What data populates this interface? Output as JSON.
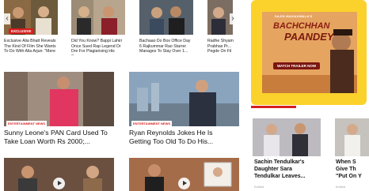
{
  "carousel": {
    "prev_icon": "chevron-left-icon",
    "next_icon": "chevron-right-icon",
    "badge": "EXCLUSIVE",
    "items": [
      {
        "caption": "Exclusive Alia Bhatt Reveals The Kind Of Film She Wants To Do With Alia Arjun: \"Mere"
      },
      {
        "caption": "Did You Know? Bappi Lahiri Once Sued Rap Legend Dr Dre For Plagiarising His So..."
      },
      {
        "caption": "Bachaao Do Box Office Day 6 Rajkummar Rao Starrer Manages To Stay Over 1..."
      },
      {
        "caption": "Radhe Shyam Prabhas Pr... Pegde On Fil"
      }
    ]
  },
  "ad": {
    "small_text": "SAJID NADIADWALA'S",
    "title_line1": "BACHCHHAN",
    "title_line2": "PAANDEY",
    "cta": "WATCH TRAILER NOW"
  },
  "stories": [
    {
      "badge": "ENTERTAINMENT NEWS",
      "headline_line1": "Sunny Leone's PAN Card Used To",
      "headline_line2": "Take Loan Worth Rs 2000;..."
    },
    {
      "badge": "ENTERTAINMENT NEWS",
      "headline_line1": "Ryan Reynolds Jokes He Is",
      "headline_line2": "Getting Too Old To Do His..."
    }
  ],
  "side": [
    {
      "title_line1": "Sachin Tendulkar's",
      "title_line2": "Daughter Sara",
      "title_line3": "Tendulkar Leaves...",
      "source": "Koimoi"
    },
    {
      "title_line1": "When S",
      "title_line2": "Give Th",
      "title_line3": "\"Put On Y",
      "source": "Koimoi"
    }
  ],
  "colors": {
    "accent": "#d71e1e",
    "ad_frame": "#fbd22b",
    "ad_cta": "#7b1712"
  }
}
